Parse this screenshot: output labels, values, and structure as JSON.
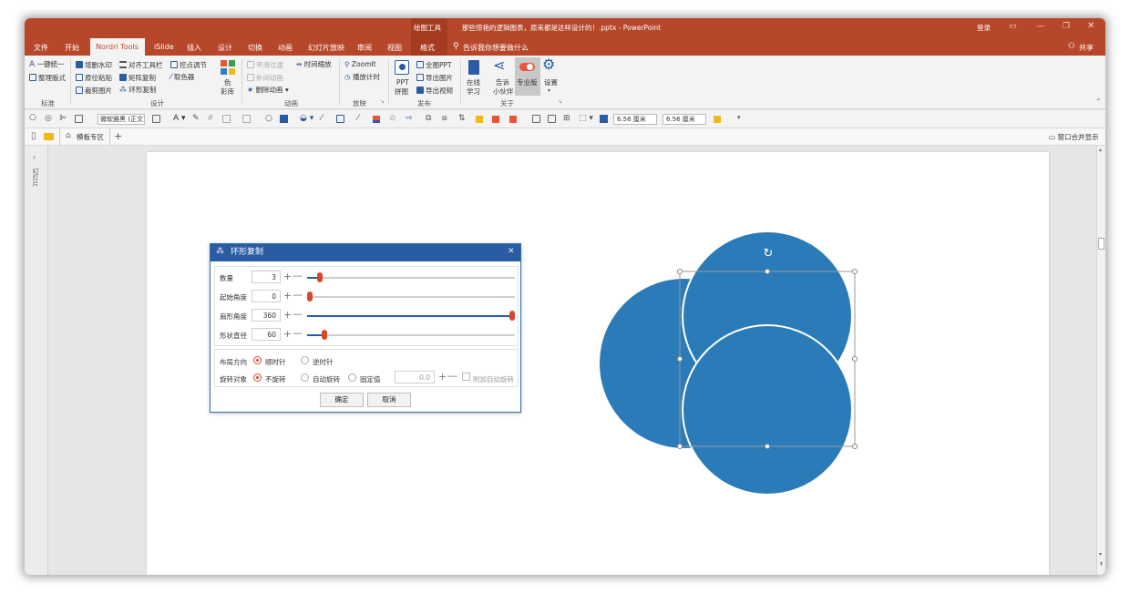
{
  "window": {
    "context_tab": "绘图工具",
    "doc_title": "那些惊艳的逻辑图表，原来都是这样设计的！.pptx - PowerPoint",
    "login": "登录",
    "share": "共享",
    "tell_me": "告诉我你想要做什么"
  },
  "tabs": [
    "文件",
    "开始",
    "Nordri Tools",
    "iSlide",
    "插入",
    "设计",
    "切换",
    "动画",
    "幻灯片放映",
    "审阅",
    "视图",
    "格式"
  ],
  "ribbon": {
    "std": {
      "a": "一键统一",
      "b": "整理版式",
      "label": "标准"
    },
    "design": {
      "r1a": "增删水印",
      "r1b": "对齐工具栏",
      "r1c": "控点调节",
      "r2a": "原位粘贴",
      "r2b": "矩阵复制",
      "r2c": "取色器",
      "r3a": "裁剪图片",
      "r3b": "环形复制",
      "label": "设计"
    },
    "colors": {
      "l1": "色",
      "l2": "彩库"
    },
    "anim": {
      "a": "平滑过渡",
      "b": "时间缩放",
      "c": "补间动画",
      "d": "删除动画",
      "label": "动画"
    },
    "play": {
      "a": "ZoomIt",
      "b": "播放计时",
      "label": "放映"
    },
    "publish": {
      "big1": "PPT",
      "big2": "拼图",
      "a": "全图PPT",
      "b": "导出图片",
      "c": "导出视频",
      "label": "发布"
    },
    "about": {
      "online1": "在线",
      "online2": "学习",
      "tell1": "告诉",
      "tell2": "小伙伴",
      "pro": "专业版",
      "settings": "设置",
      "label": "关于"
    }
  },
  "toolbar2": {
    "font": "微软雅黑 (正文)",
    "w": "6.56 厘米",
    "h": "6.56 厘米"
  },
  "doctabs": {
    "templates": "模板专区",
    "merge": "窗口合并显示"
  },
  "leftpane": {
    "label": "幻灯片"
  },
  "dialog": {
    "title": "环形复制",
    "rows": [
      {
        "label": "数量",
        "value": "3",
        "level": 0.05
      },
      {
        "label": "起始角度",
        "value": "0",
        "level": 0.0
      },
      {
        "label": "扇形角度",
        "value": "360",
        "level": 1.0
      },
      {
        "label": "形状直径",
        "value": "60",
        "level": 0.07
      }
    ],
    "layout_label": "布局方向",
    "cw": "顺时针",
    "ccw": "逆时针",
    "rotate_label": "旋转对象",
    "norot": "不旋转",
    "autorot": "自动旋转",
    "fixed": "固定值",
    "fixed_value": "0.0",
    "extra": "附加自动旋转",
    "ok": "确定",
    "cancel": "取消"
  },
  "colors": {
    "title": "#b7472a",
    "circle": "#2b7bb9",
    "thumb": "#d9472b",
    "dialog_title": "#2a5ca3"
  }
}
